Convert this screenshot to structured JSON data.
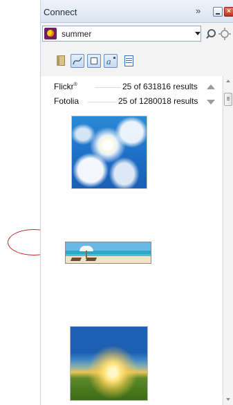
{
  "window": {
    "title": "Connect",
    "more_glyph": "»",
    "close_glyph": "×"
  },
  "search": {
    "value": "summer"
  },
  "toolbar": {
    "items": [
      {
        "icon": "book-icon",
        "active": false
      },
      {
        "icon": "curve-icon",
        "active": true
      },
      {
        "icon": "frame-icon",
        "active": true
      },
      {
        "icon": "artistic-text-icon",
        "active": true,
        "glyph": "a"
      },
      {
        "icon": "document-icon",
        "active": false
      }
    ]
  },
  "providers": [
    {
      "name": "Flickr",
      "mark": "®",
      "results": "25 of 631816 results"
    },
    {
      "name": "Fotolia",
      "mark": "",
      "results": "25 of 1280018 results"
    }
  ],
  "thumbnails": [
    {
      "subject": "sky-with-sun"
    },
    {
      "subject": "beach-umbrella"
    },
    {
      "subject": "sunset-field"
    }
  ],
  "colors": {
    "annotation_circle": "#d21f1f",
    "title_bar": "#dbe5f1",
    "active_tool_border": "#6a8fb8",
    "close_button": "#c3311d"
  }
}
